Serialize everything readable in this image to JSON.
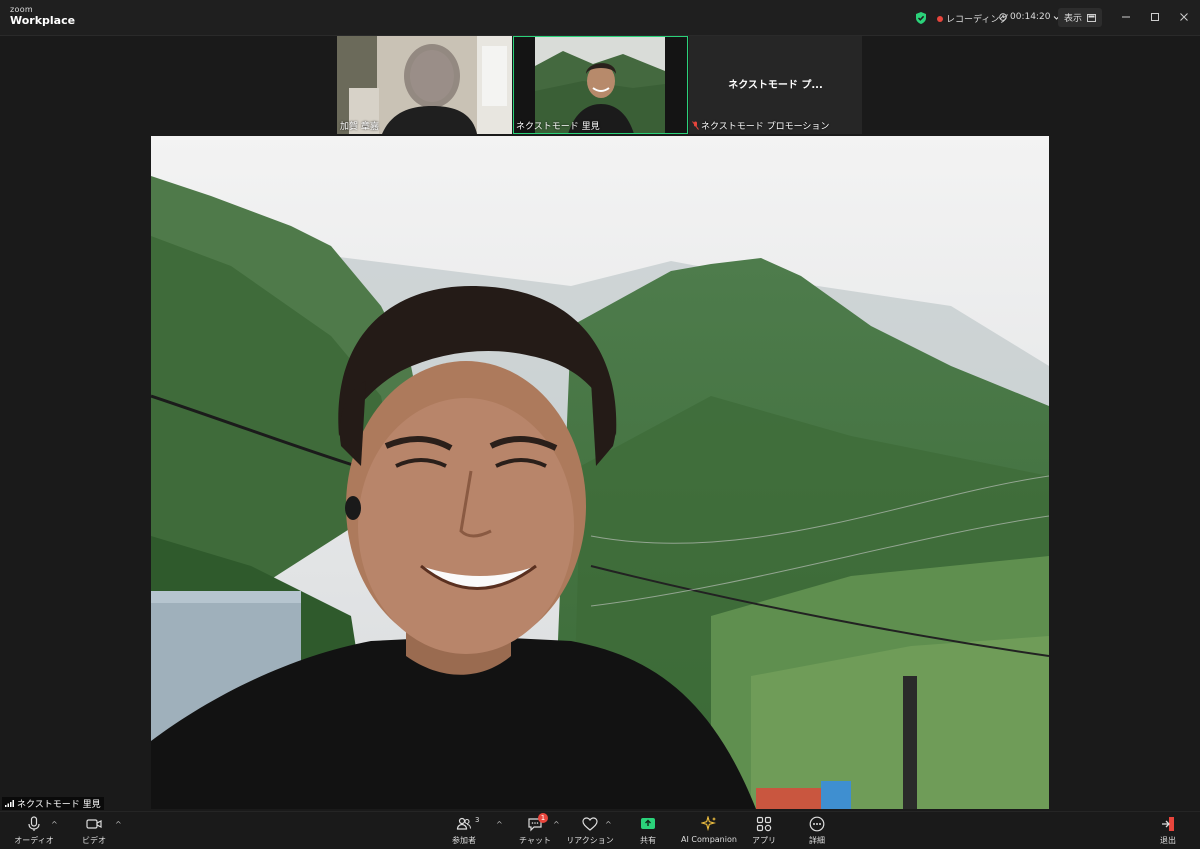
{
  "app": {
    "logo_top": "zoom",
    "logo_bottom": "Workplace"
  },
  "titlebar": {
    "recording": "レコーディング",
    "timer": "00:14:20",
    "view": "表示"
  },
  "participants": [
    {
      "name": "加賀 章嘉"
    },
    {
      "name": "ネクストモード 里見"
    },
    {
      "name": "ネクストモード プロモーション",
      "tile_title": "ネクストモード プ..."
    }
  ],
  "speaker": {
    "name": "ネクストモード 里見"
  },
  "toolbar": {
    "audio": "オーディオ",
    "video": "ビデオ",
    "participants": "参加者",
    "participants_count": "3",
    "chat": "チャット",
    "chat_badge": "1",
    "reactions": "リアクション",
    "share": "共有",
    "ai_companion": "AI Companion",
    "apps": "アプリ",
    "more": "詳細",
    "leave": "退出"
  },
  "colors": {
    "accent": "#2bd27a",
    "recording": "#e8453c",
    "leave": "#e8453c"
  }
}
